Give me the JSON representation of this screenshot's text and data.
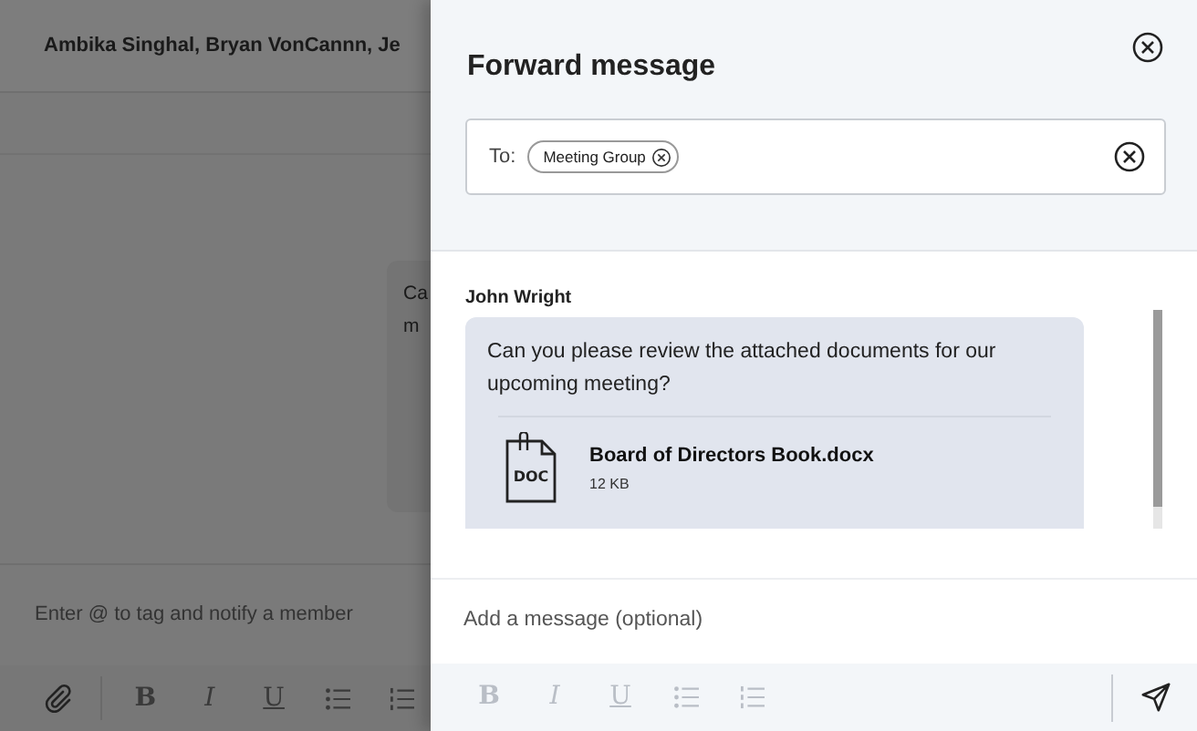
{
  "background_chat": {
    "title": "Ambika Singhal, Bryan VonCannn, Je",
    "message_lines": [
      "Ca",
      "m"
    ],
    "input": {
      "placeholder": "Enter @ to tag and notify a member"
    },
    "toolbar": [
      {
        "kind": "attach"
      },
      {
        "kind": "bold",
        "label": "B"
      },
      {
        "kind": "italic",
        "label": "I"
      },
      {
        "kind": "underline",
        "label": "U"
      },
      {
        "kind": "bullets"
      },
      {
        "kind": "numbers"
      }
    ]
  },
  "dialog": {
    "title": "Forward message",
    "to": {
      "label": "To:",
      "recipients": [
        {
          "name": "Meeting Group"
        }
      ]
    },
    "message": {
      "sender": "John Wright",
      "text": "Can you please review the attached documents for our upcoming meeting?",
      "attachment": {
        "type": "DOC",
        "name": "Board of Directors Book.docx",
        "size": "12 KB"
      }
    },
    "compose": {
      "placeholder": "Add a message (optional)"
    },
    "toolbar": [
      {
        "kind": "bold",
        "label": "B"
      },
      {
        "kind": "italic",
        "label": "I"
      },
      {
        "kind": "underline",
        "label": "U"
      },
      {
        "kind": "bullets"
      },
      {
        "kind": "numbers"
      }
    ]
  }
}
